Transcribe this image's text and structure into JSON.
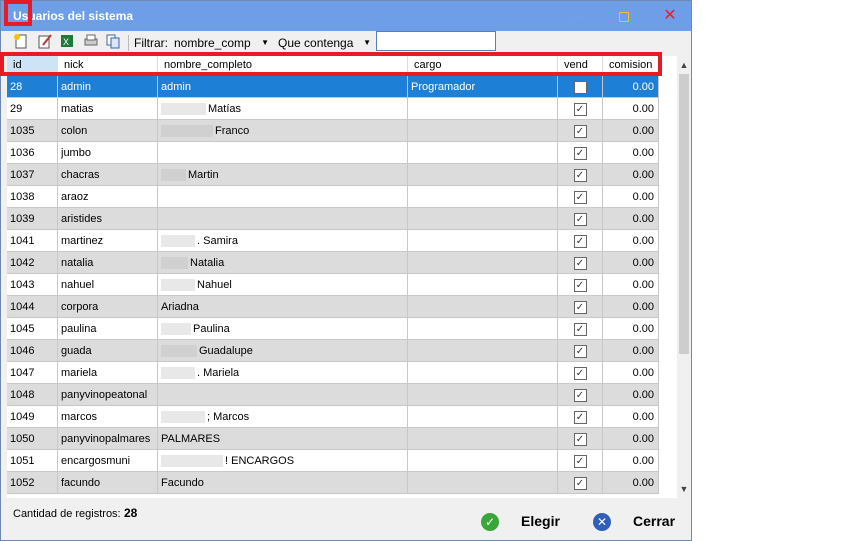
{
  "window": {
    "title": "Usuarios del sistema",
    "min_glyph": "",
    "max_glyph": "",
    "close_glyph": "✕"
  },
  "toolbar": {
    "icons": [
      "new-record-icon",
      "edit-icon",
      "excel-icon",
      "print-icon",
      "copy-icon"
    ],
    "filter_label": "Filtrar:",
    "field_combo": "nombre_comp",
    "condition_combo": "Que contenga",
    "search_value": ""
  },
  "grid": {
    "columns": [
      "id",
      "nick",
      "nombre_completo",
      "cargo",
      "vend",
      "comision"
    ],
    "rows": [
      {
        "id": "28",
        "nick": "admin",
        "nombre": "admin",
        "blur": 0,
        "cargo": "Programador",
        "vend": false,
        "comision": "0.00"
      },
      {
        "id": "29",
        "nick": "matias",
        "nombre": "Matías",
        "blur": 45,
        "cargo": "",
        "vend": true,
        "comision": "0.00"
      },
      {
        "id": "1035",
        "nick": "colon",
        "nombre": "Franco",
        "blur": 52,
        "cargo": "",
        "vend": true,
        "comision": "0.00"
      },
      {
        "id": "1036",
        "nick": "jumbo",
        "nombre": "",
        "blur": 0,
        "cargo": "",
        "vend": true,
        "comision": "0.00"
      },
      {
        "id": "1037",
        "nick": "chacras",
        "nombre": "Martin",
        "blur": 25,
        "cargo": "",
        "vend": true,
        "comision": "0.00"
      },
      {
        "id": "1038",
        "nick": "araoz",
        "nombre": "",
        "blur": 0,
        "cargo": "",
        "vend": true,
        "comision": "0.00"
      },
      {
        "id": "1039",
        "nick": "aristides",
        "nombre": "",
        "blur": 0,
        "cargo": "",
        "vend": true,
        "comision": "0.00"
      },
      {
        "id": "1041",
        "nick": "martinez",
        "nombre": ". Samira",
        "blur": 34,
        "cargo": "",
        "vend": true,
        "comision": "0.00"
      },
      {
        "id": "1042",
        "nick": "natalia",
        "nombre": "Natalia",
        "blur": 27,
        "cargo": "",
        "vend": true,
        "comision": "0.00"
      },
      {
        "id": "1043",
        "nick": "nahuel",
        "nombre": "Nahuel",
        "blur": 34,
        "cargo": "",
        "vend": true,
        "comision": "0.00"
      },
      {
        "id": "1044",
        "nick": "corpora",
        "nombre": "Ariadna",
        "blur": 0,
        "cargo": "",
        "vend": true,
        "comision": "0.00"
      },
      {
        "id": "1045",
        "nick": "paulina",
        "nombre": "Paulina",
        "blur": 30,
        "cargo": "",
        "vend": true,
        "comision": "0.00"
      },
      {
        "id": "1046",
        "nick": "guada",
        "nombre": "Guadalupe",
        "blur": 36,
        "cargo": "",
        "vend": true,
        "comision": "0.00"
      },
      {
        "id": "1047",
        "nick": "mariela",
        "nombre": ". Mariela",
        "blur": 34,
        "cargo": "",
        "vend": true,
        "comision": "0.00"
      },
      {
        "id": "1048",
        "nick": "panyvinopeatonal",
        "nombre": "",
        "blur": 0,
        "cargo": "",
        "vend": true,
        "comision": "0.00"
      },
      {
        "id": "1049",
        "nick": "marcos",
        "nombre": "; Marcos",
        "blur": 44,
        "cargo": "",
        "vend": true,
        "comision": "0.00"
      },
      {
        "id": "1050",
        "nick": "panyvinopalmares",
        "nombre": "PALMARES",
        "blur": 0,
        "cargo": "",
        "vend": true,
        "comision": "0.00"
      },
      {
        "id": "1051",
        "nick": "encargosmuni",
        "nombre": "! ENCARGOS",
        "blur": 62,
        "cargo": "",
        "vend": true,
        "comision": "0.00"
      },
      {
        "id": "1052",
        "nick": "facundo",
        "nombre": "Facundo",
        "blur": 0,
        "cargo": "",
        "vend": true,
        "comision": "0.00"
      }
    ]
  },
  "footer": {
    "count_label": "Cantidad de registros:",
    "count_value": "28",
    "elegir_label": "Elegir",
    "cerrar_label": "Cerrar"
  },
  "colors": {
    "selection": "#1e7fd6",
    "title_bar": "#6e9ee8",
    "highlight": "#e51c23"
  }
}
